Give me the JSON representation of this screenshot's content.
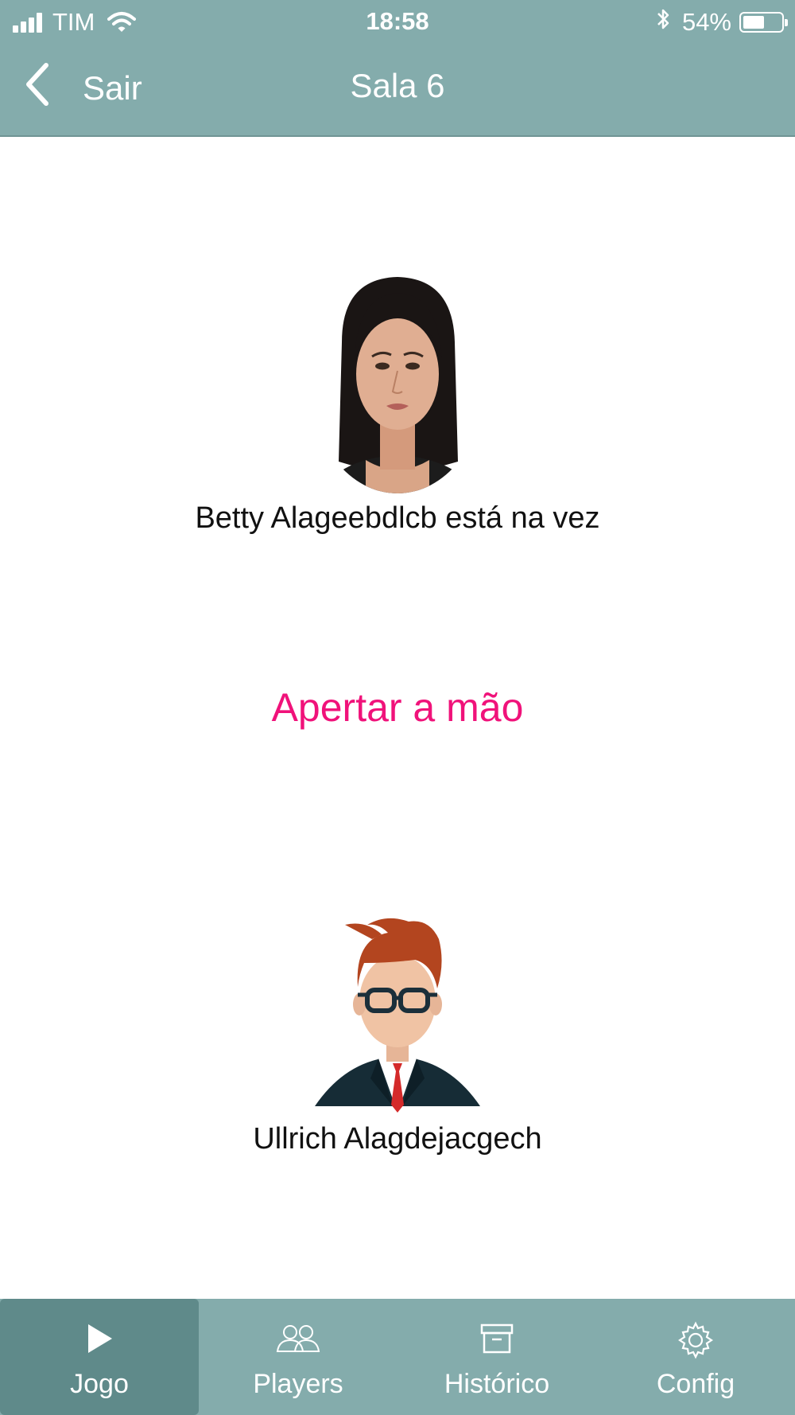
{
  "status_bar": {
    "carrier": "TIM",
    "time": "18:58",
    "battery": "54%",
    "battery_level": 0.54
  },
  "nav": {
    "back_label": "Sair",
    "title": "Sala 6"
  },
  "players": {
    "current": {
      "name_line": "Betty Alageebdlcb está na vez"
    },
    "other": {
      "name_line": "Ullrich Alagdejacgech"
    }
  },
  "action": {
    "label": "Apertar a mão"
  },
  "tab_bar": {
    "tabs": [
      {
        "label": "Jogo",
        "icon": "play-icon",
        "active": true
      },
      {
        "label": "Players",
        "icon": "people-icon",
        "active": false
      },
      {
        "label": "Histórico",
        "icon": "archive-box-icon",
        "active": false
      },
      {
        "label": "Config",
        "icon": "gear-icon",
        "active": false
      }
    ]
  },
  "colors": {
    "bar": "#84acac",
    "active_tab": "#5f8a8a",
    "accent": "#f0127a"
  }
}
